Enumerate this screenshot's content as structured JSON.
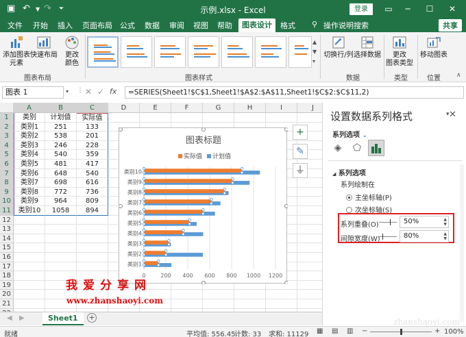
{
  "window": {
    "title": "示例.xlsx  -  Excel",
    "login": "登录",
    "share": "共享"
  },
  "tabs": [
    "文件",
    "开始",
    "插入",
    "页面布局",
    "公式",
    "数据",
    "审阅",
    "视图",
    "帮助",
    "图表设计",
    "格式"
  ],
  "tell_me": "操作说明搜索",
  "ribbon": {
    "add_element": "添加图表\n元素",
    "quick_layout": "快速布局",
    "change_color": "更改\n颜色",
    "switch_rowcol": "切换行/列",
    "select_data": "选择数据",
    "change_type": "更改\n图表类型",
    "move_chart": "移动图表",
    "groups": {
      "layout": "图表布局",
      "styles": "图表样式",
      "data": "数据",
      "type": "类型",
      "location": "位置"
    }
  },
  "formula_bar": {
    "name": "图表 1",
    "fx": "fx",
    "formula": "=SERIES(Sheet1!$C$1,Sheet1!$A$2:$A$11,Sheet1!$C$2:$C$11,2)"
  },
  "grid": {
    "columns": [
      "A",
      "B",
      "C",
      "D",
      "E",
      "F",
      "G",
      "H",
      "I",
      "J"
    ],
    "rows": [
      "1",
      "2",
      "3",
      "4",
      "5",
      "6",
      "7",
      "8",
      "9",
      "10",
      "11",
      "12",
      "13",
      "14",
      "15",
      "16",
      "17",
      "18",
      "19",
      "20",
      "21",
      "22"
    ],
    "header": [
      "类别",
      "计划值",
      "实际值"
    ],
    "data": [
      [
        "类别1",
        "251",
        "133"
      ],
      [
        "类别2",
        "538",
        "201"
      ],
      [
        "类别3",
        "246",
        "228"
      ],
      [
        "类别4",
        "540",
        "359"
      ],
      [
        "类别5",
        "481",
        "417"
      ],
      [
        "类别6",
        "648",
        "540"
      ],
      [
        "类别7",
        "698",
        "616"
      ],
      [
        "类别8",
        "772",
        "736"
      ],
      [
        "类别9",
        "964",
        "809"
      ],
      [
        "类别10",
        "1058",
        "894"
      ]
    ]
  },
  "chart_data": {
    "type": "bar",
    "orientation": "horizontal",
    "title": "图表标题",
    "categories": [
      "类别1",
      "类别2",
      "类别3",
      "类别4",
      "类别5",
      "类别6",
      "类别7",
      "类别8",
      "类别9",
      "类别10"
    ],
    "series": [
      {
        "name": "实际值",
        "color": "#ed7d31",
        "values": [
          133,
          201,
          228,
          359,
          417,
          540,
          616,
          736,
          809,
          894
        ]
      },
      {
        "name": "计划值",
        "color": "#5b9bd5",
        "values": [
          251,
          538,
          246,
          540,
          481,
          648,
          698,
          772,
          964,
          1058
        ]
      }
    ],
    "xticks": [
      "0",
      "200",
      "400",
      "600",
      "800",
      "1000",
      "1200"
    ],
    "xlim": [
      0,
      1200
    ],
    "legend": "top",
    "grid": true
  },
  "pane": {
    "title": "设置数据系列格式",
    "options_dropdown": "系列选项",
    "section": "系列选项",
    "plot_on": "系列绘制在",
    "primary_axis": "主坐标轴(P)",
    "secondary_axis": "次坐标轴(S)",
    "overlap_label": "系列重叠(O)",
    "overlap_value": "50%",
    "gap_label": "间隙宽度(W)",
    "gap_value": "80%"
  },
  "sheet_tab": "Sheet1",
  "status": {
    "ready": "就绪",
    "average": "平均值: 556.45",
    "count": "计数: 33",
    "sum": "求和: 11129",
    "zoom": "100%"
  },
  "watermark": {
    "line1": "我爱分享网",
    "line2": "www.zhanshaoyi.com",
    "corner": "zhanshaoyi.com"
  },
  "colors": {
    "accent": "#217346",
    "actual": "#ed7d31",
    "plan": "#5b9bd5",
    "highlight": "#e02020"
  }
}
